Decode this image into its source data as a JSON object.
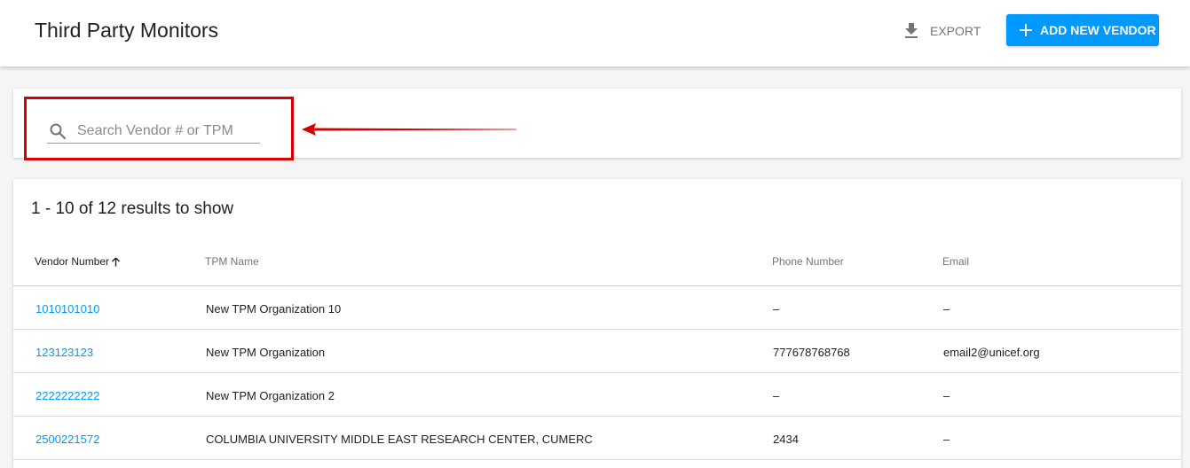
{
  "header": {
    "title": "Third Party Monitors",
    "export_label": "EXPORT",
    "add_label": "ADD NEW VENDOR"
  },
  "search": {
    "placeholder": "Search Vendor # or TPM",
    "value": ""
  },
  "table": {
    "results_title": "1 - 10 of 12 results to show",
    "columns": [
      "Vendor Number",
      "TPM Name",
      "Phone Number",
      "Email"
    ],
    "sort": {
      "column": "Vendor Number",
      "direction": "ascending"
    },
    "rows": [
      {
        "vendor": "1010101010",
        "name": "New TPM Organization 10",
        "phone": "–",
        "email": "–"
      },
      {
        "vendor": "123123123",
        "name": "New TPM Organization",
        "phone": "777678768768",
        "email": "email2@unicef.org"
      },
      {
        "vendor": "2222222222",
        "name": "New TPM Organization 2",
        "phone": "–",
        "email": "–"
      },
      {
        "vendor": "2500221572",
        "name": "COLUMBIA UNIVERSITY MIDDLE EAST RESEARCH CENTER, CUMERC",
        "phone": "2434",
        "email": "–"
      }
    ]
  },
  "icons": {
    "export": "download-icon",
    "add": "plus-icon",
    "search": "search-icon",
    "sort": "arrow-up-icon"
  },
  "colors": {
    "accent": "#0099ff",
    "annotation": "#d60000"
  }
}
